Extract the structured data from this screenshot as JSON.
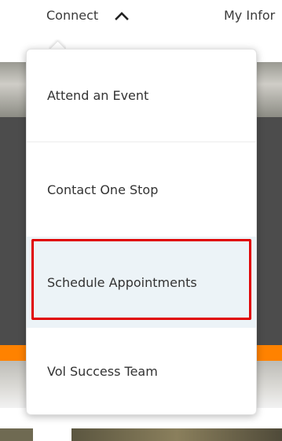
{
  "nav": {
    "connect_label": "Connect",
    "connect_icon": "chevron-up-icon",
    "myinfo_label": "My Infor"
  },
  "dropdown": {
    "items": [
      {
        "label": "Attend an Event"
      },
      {
        "label": "Contact One Stop"
      },
      {
        "label": "Schedule Appointments",
        "highlighted": true
      },
      {
        "label": "Vol Success Team"
      }
    ]
  },
  "colors": {
    "accent_orange": "#ff8200",
    "highlight_red": "#e00000",
    "hover_bg": "#ecf3f7"
  }
}
